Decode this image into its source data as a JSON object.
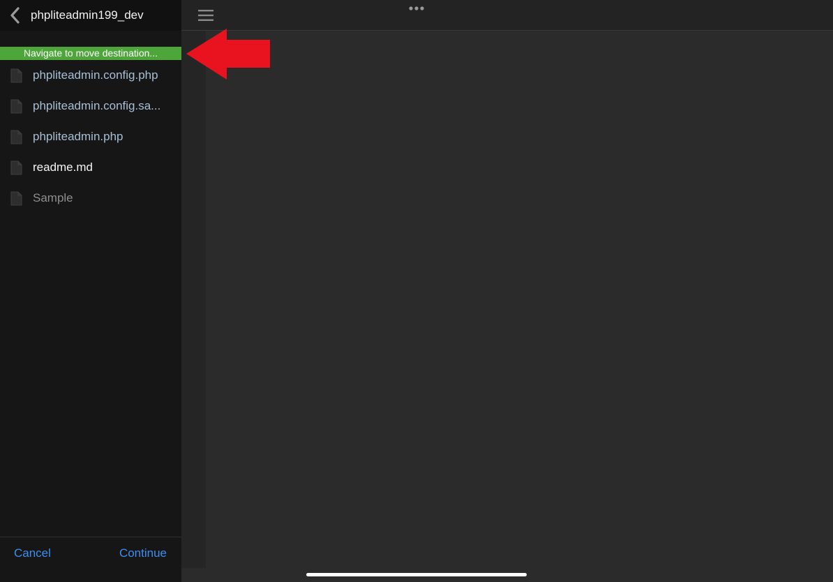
{
  "sidebar": {
    "title": "phpliteadmin199_dev",
    "back_icon": "chevron-left-icon",
    "banner": "Navigate to move destination...",
    "files": [
      {
        "name": "phpliteadmin.config.php",
        "kind": "php",
        "icon": "document-icon"
      },
      {
        "name": "phpliteadmin.config.sa...",
        "kind": "php",
        "icon": "document-icon"
      },
      {
        "name": "phpliteadmin.php",
        "kind": "php",
        "icon": "document-icon"
      },
      {
        "name": "readme.md",
        "kind": "md",
        "icon": "document-icon"
      },
      {
        "name": "Sample",
        "kind": "other",
        "icon": "document-icon"
      }
    ],
    "footer": {
      "cancel_label": "Cancel",
      "continue_label": "Continue"
    }
  },
  "toolbar": {
    "menu_icon": "hamburger-menu-icon",
    "more_icon": "more-dots-icon"
  },
  "colors": {
    "banner": "#4ea63b",
    "link": "#3d8ef0",
    "arrow": "#e8131e"
  }
}
